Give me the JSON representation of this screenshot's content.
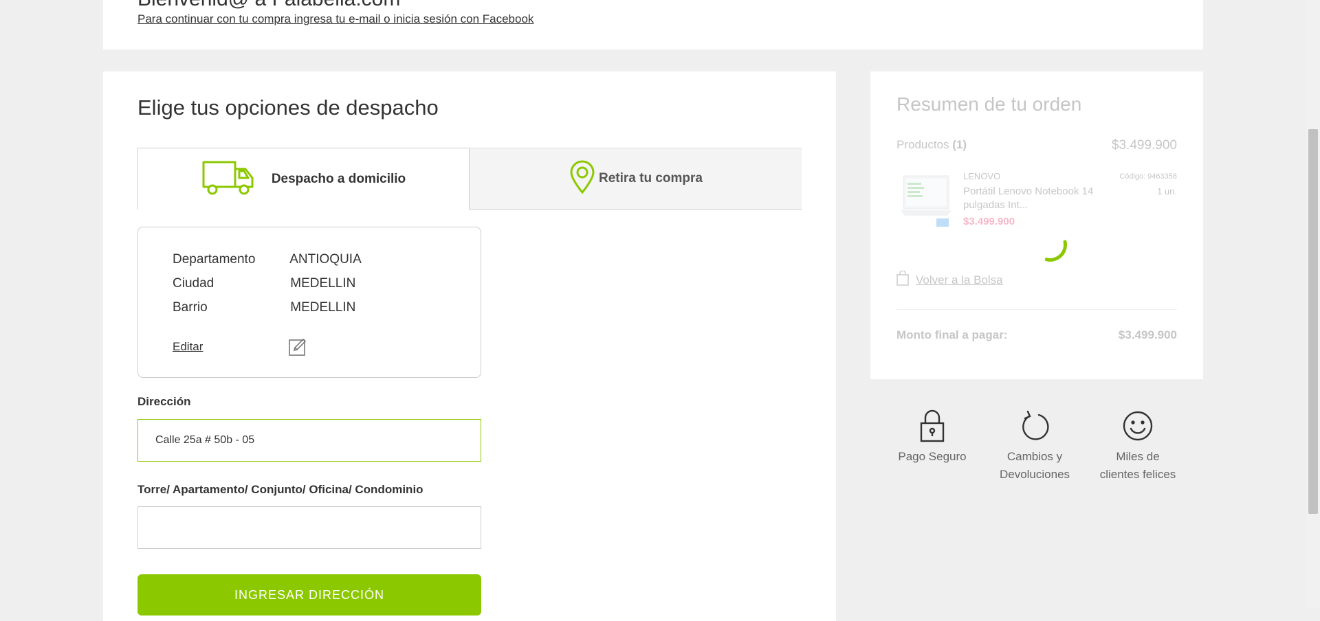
{
  "header": {
    "title_partial": "Bienvenid@ a Falabella.com",
    "subtitle_link": "Para continuar con tu compra ingresa tu e-mail o inicia sesión con Facebook"
  },
  "shipping": {
    "title": "Elige tus opciones de despacho",
    "tabs": [
      {
        "label": "Despacho a domicilio",
        "icon": "truck-icon",
        "selected": true
      },
      {
        "label": "Retira tu compra",
        "icon": "location-pin-icon",
        "selected": false
      }
    ],
    "location": {
      "rows": [
        {
          "label": "Departamento",
          "value": "ANTIOQUIA"
        },
        {
          "label": "Ciudad",
          "value": "MEDELLIN"
        },
        {
          "label": "Barrio",
          "value": "MEDELLIN"
        }
      ],
      "edit_label": "Editar"
    },
    "address_label": "Dirección",
    "address_value": "Calle 25a # 50b - 05",
    "extra_label": "Torre/ Apartamento/ Conjunto/ Oficina/ Condominio",
    "extra_value": "",
    "submit_label": "INGRESAR DIRECCIÓN"
  },
  "summary": {
    "title": "Resumen de tu orden",
    "products_label": "Productos",
    "products_count": "(1)",
    "products_total": "$3.499.900",
    "product": {
      "brand": "LENOVO",
      "name": "Portátil Lenovo Notebook 14 pulgadas Int...",
      "price": "$3.499.900",
      "code": "Código: 9463358",
      "qty": "1 un."
    },
    "back_label": "Volver a la Bolsa",
    "total_label": "Monto final a pagar:",
    "total_value": "$3.499.900"
  },
  "badges": [
    {
      "icon": "lock-icon",
      "line1": "Pago Seguro",
      "line2": ""
    },
    {
      "icon": "refresh-icon",
      "line1": "Cambios y",
      "line2": "Devoluciones"
    },
    {
      "icon": "smiley-icon",
      "line1": "Miles de",
      "line2": "clientes felices"
    }
  ],
  "colors": {
    "accent": "#8cc800",
    "price": "#e0003c",
    "background": "#efefef"
  }
}
